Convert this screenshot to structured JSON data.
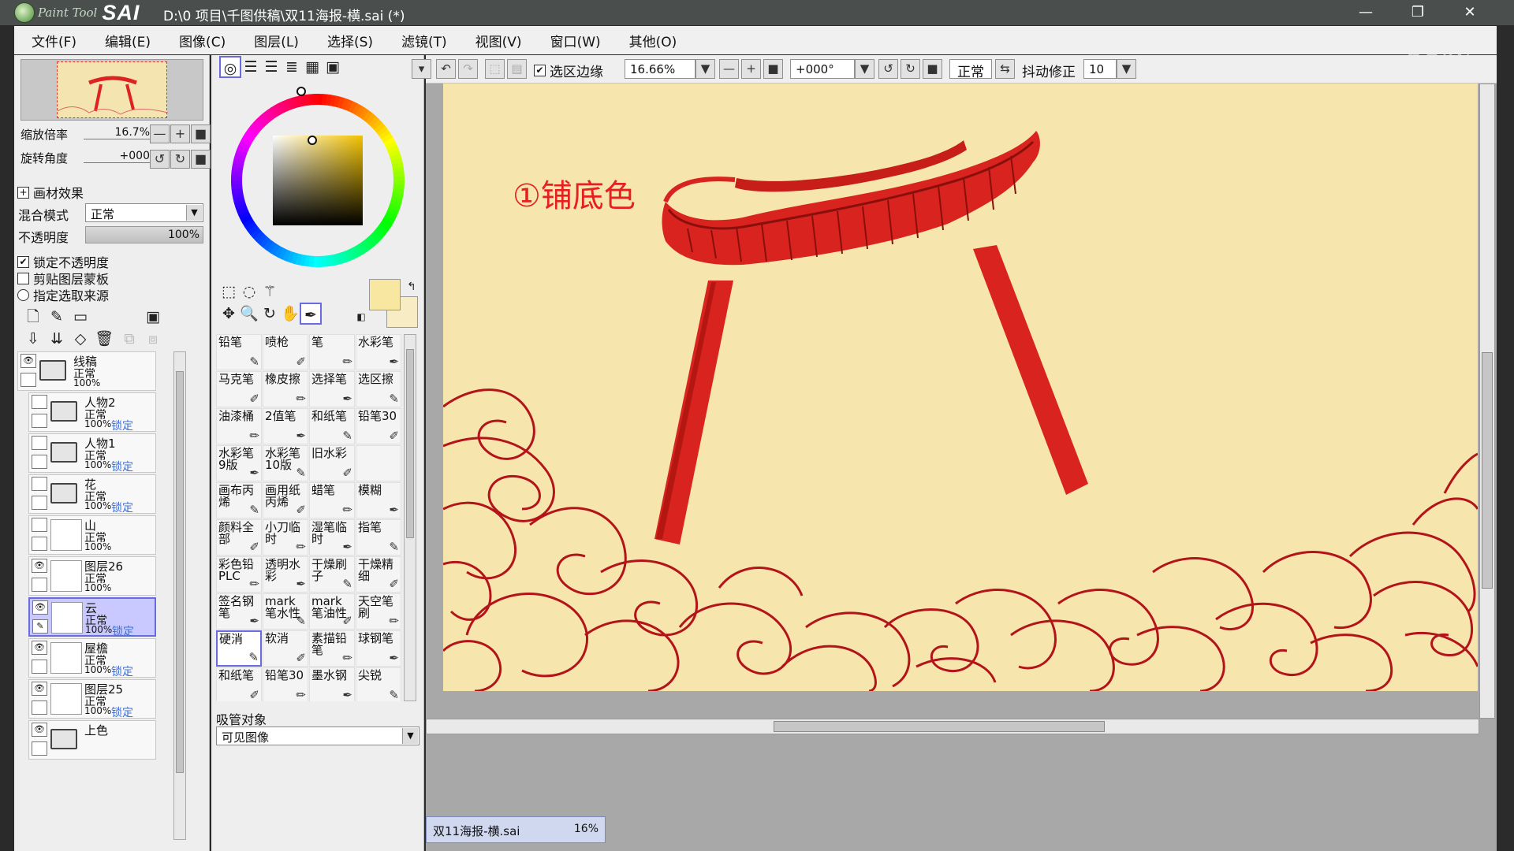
{
  "window": {
    "app_name": "PaintTool SAI",
    "logo_small": "Paint Tool",
    "logo_big": "SAI",
    "title": "D:\\0 项目\\千图供稿\\双11海报-横.sai (*)",
    "watermark": "虎课"
  },
  "menu": [
    "文件(F)",
    "编辑(E)",
    "图像(C)",
    "图层(L)",
    "选择(S)",
    "滤镜(T)",
    "视图(V)",
    "窗口(W)",
    "其他(O)"
  ],
  "navigator": {
    "zoom_label": "缩放倍率",
    "zoom_value": "16.7%",
    "rotate_label": "旋转角度",
    "rotate_value": "+000"
  },
  "layer_props": {
    "texture_label": "画材效果",
    "blend_label": "混合模式",
    "blend_value": "正常",
    "opacity_label": "不透明度",
    "opacity_value": "100%",
    "lock_opacity": "锁定不透明度",
    "clip_mask": "剪贴图层蒙板",
    "select_source": "指定选取来源"
  },
  "layers": [
    {
      "name": "线稿",
      "mode": "正常",
      "opacity": "100%",
      "lock": "",
      "type": "folder",
      "visible": true
    },
    {
      "name": "人物2",
      "mode": "正常",
      "opacity": "100%",
      "lock": "锁定",
      "type": "folder",
      "visible": false
    },
    {
      "name": "人物1",
      "mode": "正常",
      "opacity": "100%",
      "lock": "锁定",
      "type": "folder",
      "visible": false
    },
    {
      "name": "花",
      "mode": "正常",
      "opacity": "100%",
      "lock": "锁定",
      "type": "folder",
      "visible": false
    },
    {
      "name": "山",
      "mode": "正常",
      "opacity": "100%",
      "lock": "",
      "type": "layer",
      "visible": false
    },
    {
      "name": "图层26",
      "mode": "正常",
      "opacity": "100%",
      "lock": "",
      "type": "layer",
      "visible": true
    },
    {
      "name": "云",
      "mode": "正常",
      "opacity": "100%",
      "lock": "锁定",
      "type": "layer",
      "visible": true,
      "selected": true
    },
    {
      "name": "屋檐",
      "mode": "正常",
      "opacity": "100%",
      "lock": "锁定",
      "type": "layer",
      "visible": true
    },
    {
      "name": "图层25",
      "mode": "正常",
      "opacity": "100%",
      "lock": "锁定",
      "type": "layer",
      "visible": true
    },
    {
      "name": "上色",
      "mode": "",
      "opacity": "",
      "lock": "",
      "type": "folder",
      "visible": true
    }
  ],
  "colors": {
    "primary": "#F8E7A1",
    "secondary": "#F7ECC4",
    "canvas_bg": "#F6E6AE",
    "gate_red": "#D9231E",
    "gate_dark": "#B41612",
    "cloud_line": "#B3141A"
  },
  "brushes": [
    [
      "铅笔",
      "喷枪",
      "笔",
      "水彩笔"
    ],
    [
      "马克笔",
      "橡皮擦",
      "选择笔",
      "选区擦"
    ],
    [
      "油漆桶",
      "2值笔",
      "和纸笔",
      "铅笔30"
    ],
    [
      "水彩笔9版",
      "水彩笔10版",
      "旧水彩",
      ""
    ],
    [
      "画布丙烯",
      "画用纸丙烯",
      "蜡笔",
      "模糊"
    ],
    [
      "颜料全部",
      "小刀临时",
      "湿笔临时",
      "指笔"
    ],
    [
      "彩色铅PLC",
      "透明水彩",
      "干燥刷子",
      "干燥精细"
    ],
    [
      "签名钢笔",
      "mark笔水性",
      "mark笔油性",
      "天空笔刷"
    ],
    [
      "硬消",
      "软消",
      "素描铅笔",
      "球钢笔"
    ],
    [
      "和纸笔",
      "铅笔30",
      "墨水钢",
      "尖锐"
    ]
  ],
  "eyedropper": {
    "label": "吸管对象",
    "value": "可见图像"
  },
  "toolbar": {
    "selection_edge": "选区边缘",
    "zoom": "16.66%",
    "rotation": "+000°",
    "blend": "正常",
    "stabilizer_label": "抖动修正",
    "stabilizer_value": "10"
  },
  "canvas": {
    "annotation": "①铺底色"
  },
  "doc_tab": {
    "name": "双11海报-横.sai",
    "zoom": "16%"
  }
}
